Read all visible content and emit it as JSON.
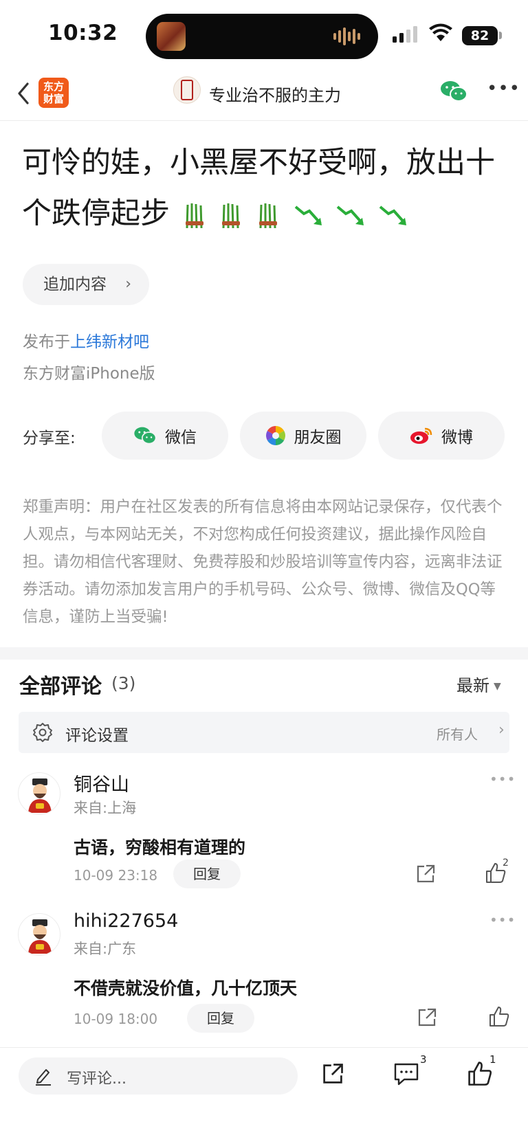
{
  "status_bar": {
    "time": "10:32",
    "battery": "82"
  },
  "nav": {
    "app_logo_line1": "东方",
    "app_logo_line2": "财富",
    "author": "专业治不服的主力"
  },
  "post": {
    "title": "可怜的娃，小黑屋不好受啊，放出十个跌停起步",
    "add_content": "追加内容",
    "published_prefix": "发布于",
    "bar_name": "上纬新材吧",
    "device": "东方财富iPhone版"
  },
  "share": {
    "label": "分享至:",
    "wechat": "微信",
    "moments": "朋友圈",
    "weibo": "微博"
  },
  "disclaimer": "郑重声明：用户在社区发表的所有信息将由本网站记录保存，仅代表个人观点，与本网站无关，不对您构成任何投资建议，据此操作风险自担。请勿相信代客理财、免费荐股和炒股培训等宣传内容，远离非法证券活动。请勿添加发言用户的手机号码、公众号、微博、微信及QQ等信息，谨防上当受骗!",
  "comments_header": {
    "title": "全部评论",
    "count": "(3)",
    "sort": "最新",
    "settings_label": "评论设置",
    "settings_value": "所有人"
  },
  "comments": [
    {
      "user": "铜谷山",
      "location": "来自:上海",
      "text": "古语，穷酸相有道理的",
      "time": "10-09 23:18",
      "reply": "回复",
      "likes": "2"
    },
    {
      "user": "hihi227654",
      "location": "来自:广东",
      "text": "不借壳就没价值，几十亿顶天",
      "time": "10-09 18:00",
      "reply": "回复",
      "likes": ""
    }
  ],
  "bottom_bar": {
    "write_placeholder": "写评论...",
    "comment_count": "3",
    "like_count": "1"
  },
  "colors": {
    "accent_orange": "#f05a1a",
    "link_blue": "#2b78d9",
    "wechat_green": "#2aae67",
    "weibo_red": "#e6162d"
  }
}
